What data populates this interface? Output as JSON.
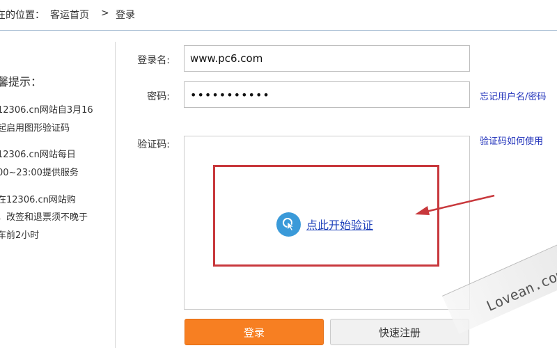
{
  "breadcrumb": {
    "prefix": "在的位置：",
    "home": "客运首页",
    "separator": ">",
    "current": "登录"
  },
  "tips": {
    "heading": "馨提示：",
    "lines": [
      "12306.cn网站自3月16",
      "起启用图形验证码",
      "12306.cn网站每日",
      "00~23:00提供服务",
      "在12306.cn网站购",
      "，改签和退票须不晚于",
      "车前2小时"
    ]
  },
  "form": {
    "username_label": "登录名:",
    "username_value": "www.pc6.com",
    "password_label": "密码:",
    "password_value": "•••••••••••",
    "captcha_label": "验证码:",
    "forgot_link": "忘记用户名/密码",
    "captcha_help_link": "验证码如何使用",
    "verify_button": "点此开始验证",
    "login_button": "登录",
    "register_button": "快速注册"
  },
  "watermark": "Lovean.com",
  "colors": {
    "login_button": "#f77f22",
    "annotation_red": "#c8383c",
    "link_blue": "#2233bb",
    "verify_icon": "#3a9ad9",
    "breadcrumb_rule": "#9fb7cf"
  },
  "icons": {
    "verify": "cursor-click-icon",
    "annotation": "red-arrow"
  }
}
